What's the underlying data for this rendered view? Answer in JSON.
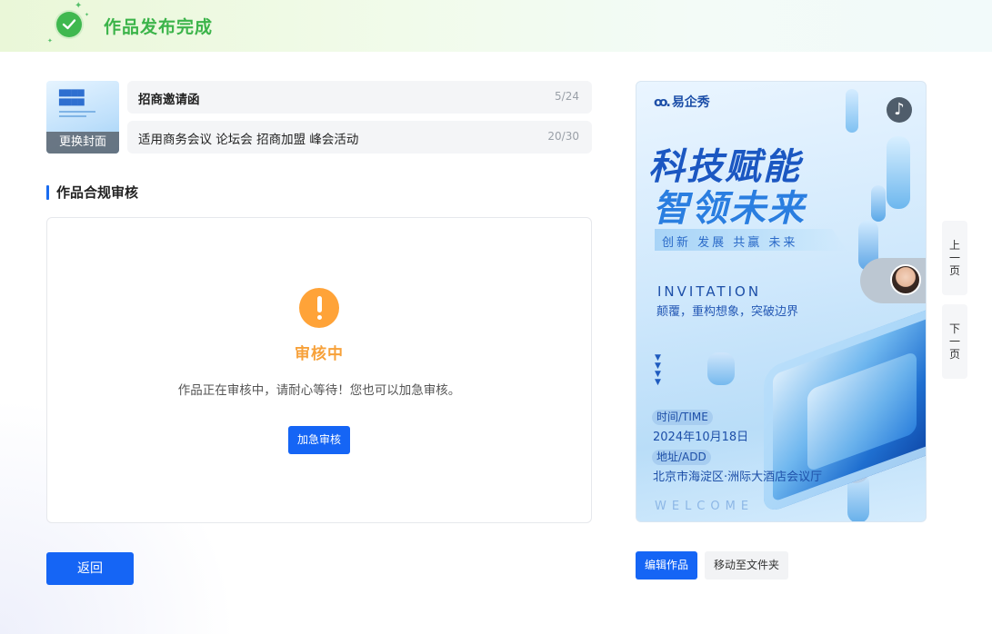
{
  "header": {
    "title": "作品发布完成",
    "icon": "check-circle-icon",
    "accent": "#3cb44a"
  },
  "work": {
    "cover_label": "更换封面",
    "title_value": "招商邀请函",
    "title_count": "5/24",
    "tags_value": "适用商务会议 论坛会 招商加盟 峰会活动",
    "tags_count": "20/30"
  },
  "review": {
    "section_title": "作品合规审核",
    "status": "审核中",
    "status_color": "#f7a13a",
    "description": "作品正在审核中，请耐心等待！您也可以加急审核。",
    "urgent_button": "加急审核"
  },
  "back_button": "返回",
  "poster": {
    "logo": "易企秀",
    "headline_1": "科技赋能",
    "headline_2": "智领未来",
    "slogan": "创新 发展 共赢 未来",
    "invitation": "INVITATION",
    "subtitle": "颠覆，重构想象，突破边界",
    "time_label": "时间/TIME",
    "time_value": "2024年10月18日",
    "addr_label": "地址/ADD",
    "addr_value": "北京市海淀区·洲际大酒店会议厅",
    "welcome": "WELCOME"
  },
  "actions": {
    "edit": "编辑作品",
    "move": "移动至文件夹"
  },
  "pager": {
    "prev": [
      "上",
      "一",
      "页"
    ],
    "next": [
      "下",
      "一",
      "页"
    ]
  },
  "colors": {
    "primary": "#1565f5"
  }
}
